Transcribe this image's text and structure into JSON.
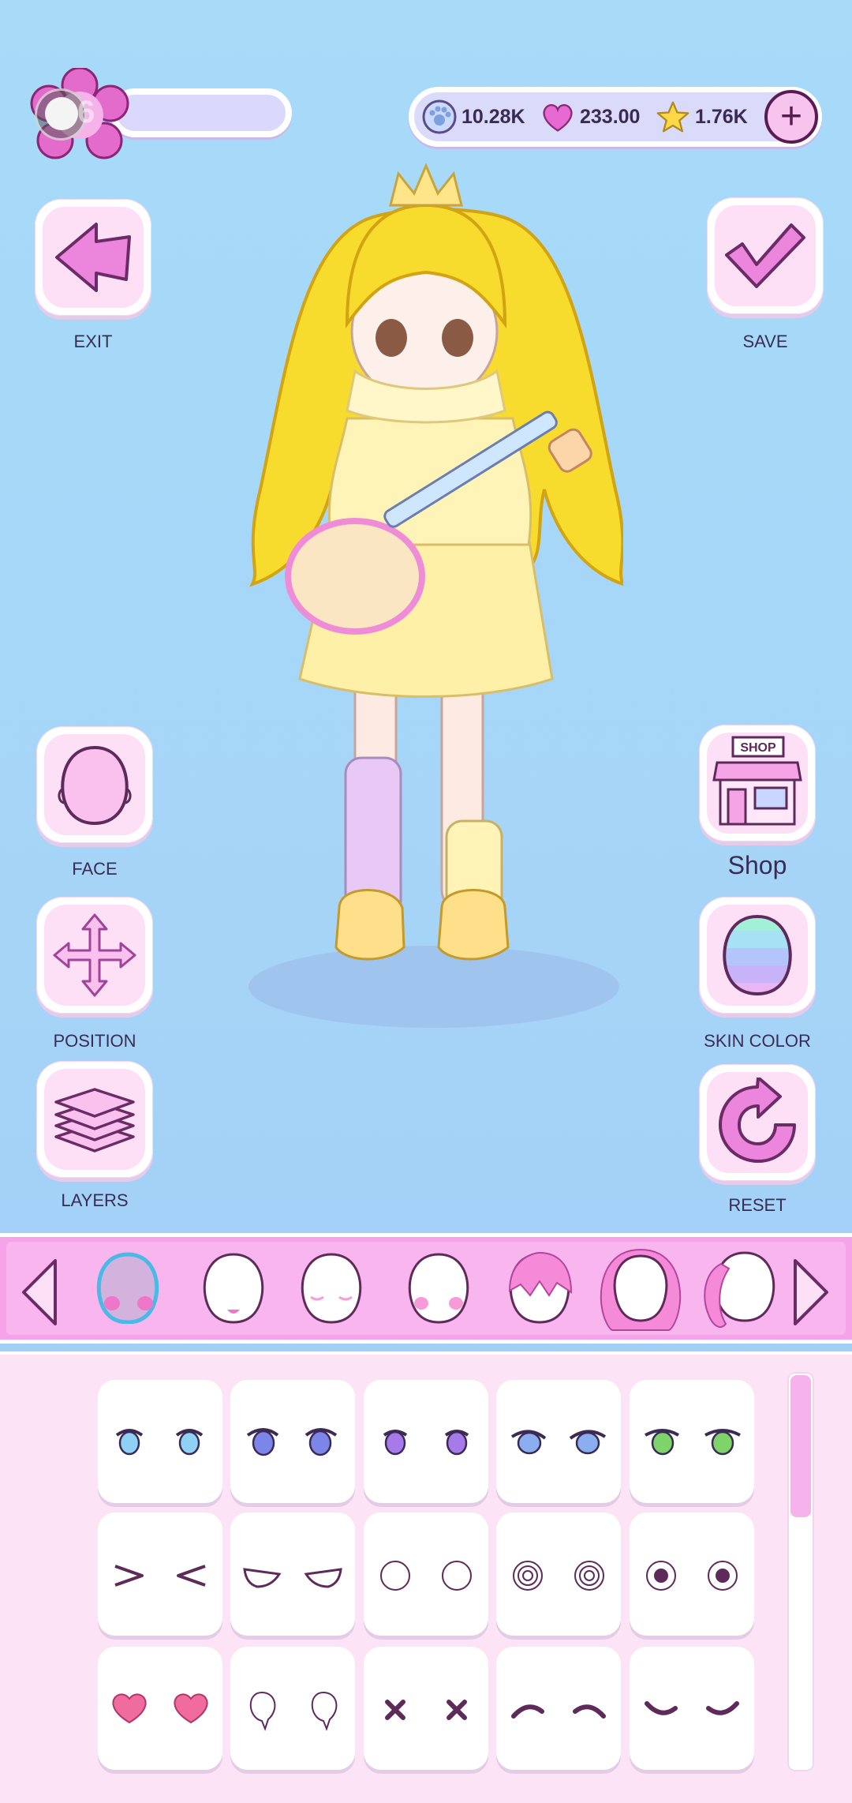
{
  "status": {
    "level": "6"
  },
  "currency": {
    "paws": "10.28K",
    "hearts": "233.00",
    "stars": "1.76K",
    "add_label": "+"
  },
  "left_buttons": {
    "exit": "EXIT",
    "face": "FACE",
    "position": "POSITION",
    "layers": "LAYERS"
  },
  "right_buttons": {
    "save": "SAVE",
    "shop": "Shop",
    "shop_sign": "SHOP",
    "skin_color": "SKIN COLOR",
    "reset": "RESET"
  },
  "icons": {
    "exit": "arrow-left-icon",
    "save": "checkmark-icon",
    "face": "face-icon",
    "position": "move-arrows-icon",
    "layers": "layers-icon",
    "shop": "shop-icon",
    "skin_color": "rainbow-head-icon",
    "reset": "reset-arrow-icon"
  },
  "category_strip": {
    "selected_index": 0,
    "items": [
      "cheeks",
      "mouth",
      "eyes-closed",
      "blush",
      "hair-front",
      "hair-back",
      "hair-side"
    ]
  },
  "eyes_grid": {
    "rows": [
      [
        "eyes-blue",
        "eyes-violet-blue",
        "eyes-purple",
        "eyes-sparkle",
        "eyes-green"
      ],
      [
        "eyes-squint",
        "eyes-sleepy",
        "eyes-empty",
        "eyes-spiral",
        "eyes-dot"
      ],
      [
        "eyes-heart",
        "eyes-tear",
        "eyes-x",
        "eyes-arc-down",
        "eyes-arc-up"
      ]
    ]
  },
  "colors": {
    "accent": "#f7a3ea",
    "text": "#3a2c55",
    "button_bg": "#fde0f6"
  }
}
